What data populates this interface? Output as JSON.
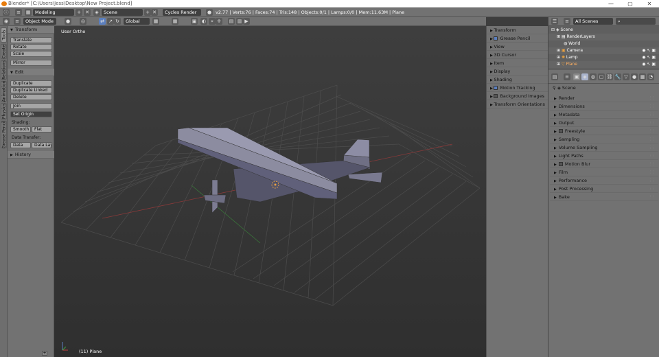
{
  "titlebar": {
    "title": "Blender* [C:\\Users\\Jess\\Desktop\\New Project.blend]",
    "minimize": "—",
    "maximize": "▢",
    "close": "✕"
  },
  "info": {
    "layout": "Modeling",
    "scene": "Scene",
    "engine": "Cycles Render",
    "stats": "v2.77 | Verts:76 | Faces:74 | Tris:148 | Objects:0/1 | Lamps:0/0 | Mem:11.63M | Plane"
  },
  "view3d_header": {
    "mode": "Object Mode",
    "orientation": "Global"
  },
  "left_tabs": [
    "Tools",
    "Create",
    "Relations",
    "Animation",
    "Physics",
    "Grease Pencil"
  ],
  "tool_shelf": {
    "transform_title": "Transform",
    "translate": "Translate",
    "rotate": "Rotate",
    "scale": "Scale",
    "mirror": "Mirror",
    "edit_title": "Edit",
    "duplicate": "Duplicate",
    "duplicate_linked": "Duplicate Linked",
    "delete": "Delete",
    "join": "Join",
    "set_origin": "Set Origin",
    "shading_label": "Shading:",
    "smooth": "Smooth",
    "flat": "Flat",
    "data_transfer_label": "Data Transfer:",
    "data": "Data",
    "data_layo": "Data Layo",
    "history_title": "History"
  },
  "viewport": {
    "view_label": "User Ortho",
    "object_label": "(11) Plane"
  },
  "n_panel": [
    {
      "label": "Transform",
      "checkbox": null
    },
    {
      "label": "Grease Pencil",
      "checkbox": true
    },
    {
      "label": "View",
      "checkbox": null
    },
    {
      "label": "3D Cursor",
      "checkbox": null
    },
    {
      "label": "Item",
      "checkbox": null
    },
    {
      "label": "Display",
      "checkbox": null
    },
    {
      "label": "Shading",
      "checkbox": null
    },
    {
      "label": "Motion Tracking",
      "checkbox": true
    },
    {
      "label": "Background Images",
      "checkbox": false
    },
    {
      "label": "Transform Orientations",
      "checkbox": null
    }
  ],
  "outliner": {
    "filter": "All Scenes",
    "items": [
      {
        "label": "Scene",
        "indent": 0
      },
      {
        "label": "RenderLayers",
        "indent": 1
      },
      {
        "label": "World",
        "indent": 1
      },
      {
        "label": "Camera",
        "indent": 1
      },
      {
        "label": "Lamp",
        "indent": 1
      },
      {
        "label": "Plane",
        "indent": 1
      }
    ]
  },
  "properties": {
    "context_label": "Scene",
    "panels": [
      {
        "label": "Render",
        "checkbox": null
      },
      {
        "label": "Dimensions",
        "checkbox": null
      },
      {
        "label": "Metadata",
        "checkbox": null
      },
      {
        "label": "Output",
        "checkbox": null
      },
      {
        "label": "Freestyle",
        "checkbox": false
      },
      {
        "label": "Sampling",
        "checkbox": null
      },
      {
        "label": "Volume Sampling",
        "checkbox": null
      },
      {
        "label": "Light Paths",
        "checkbox": null
      },
      {
        "label": "Motion Blur",
        "checkbox": false
      },
      {
        "label": "Film",
        "checkbox": null
      },
      {
        "label": "Performance",
        "checkbox": null
      },
      {
        "label": "Post Processing",
        "checkbox": null
      },
      {
        "label": "Bake",
        "checkbox": null
      }
    ]
  },
  "colors": {
    "accent": "#5b7fbf",
    "panel": "#727272",
    "viewport": "#393939"
  }
}
